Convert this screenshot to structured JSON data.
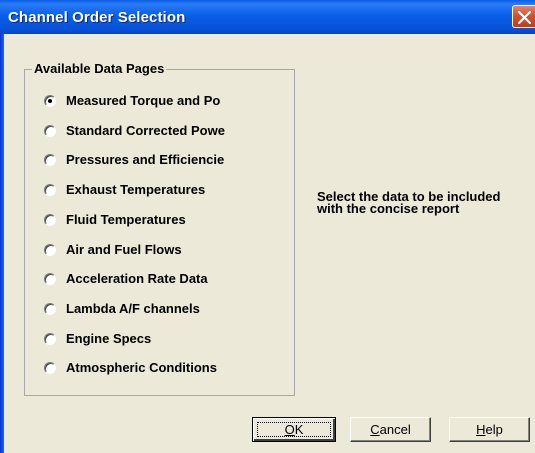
{
  "window": {
    "title": "Channel Order Selection"
  },
  "group": {
    "legend": "Available Data Pages",
    "selected_index": 0,
    "options": [
      "Measured Torque and Po",
      "Standard Corrected Powe",
      "Pressures and Efficiencie",
      "Exhaust Temperatures",
      "Fluid Temperatures",
      "Air and Fuel Flows",
      "Acceleration Rate Data",
      "Lambda A/F channels",
      "Engine Specs",
      "Atmospheric Conditions"
    ]
  },
  "info": {
    "text": "Select the data to be included with the concise report"
  },
  "buttons": {
    "ok_mnemonic": "O",
    "ok_rest": "K",
    "cancel_mnemonic": "C",
    "cancel_rest": "ancel",
    "help_mnemonic": "H",
    "help_rest": "elp"
  },
  "icons": {
    "close": "close-icon"
  },
  "colors": {
    "titlebar": "#0a5ee8",
    "close_button": "#d3532f",
    "dialog_background": "#ece9d8"
  }
}
